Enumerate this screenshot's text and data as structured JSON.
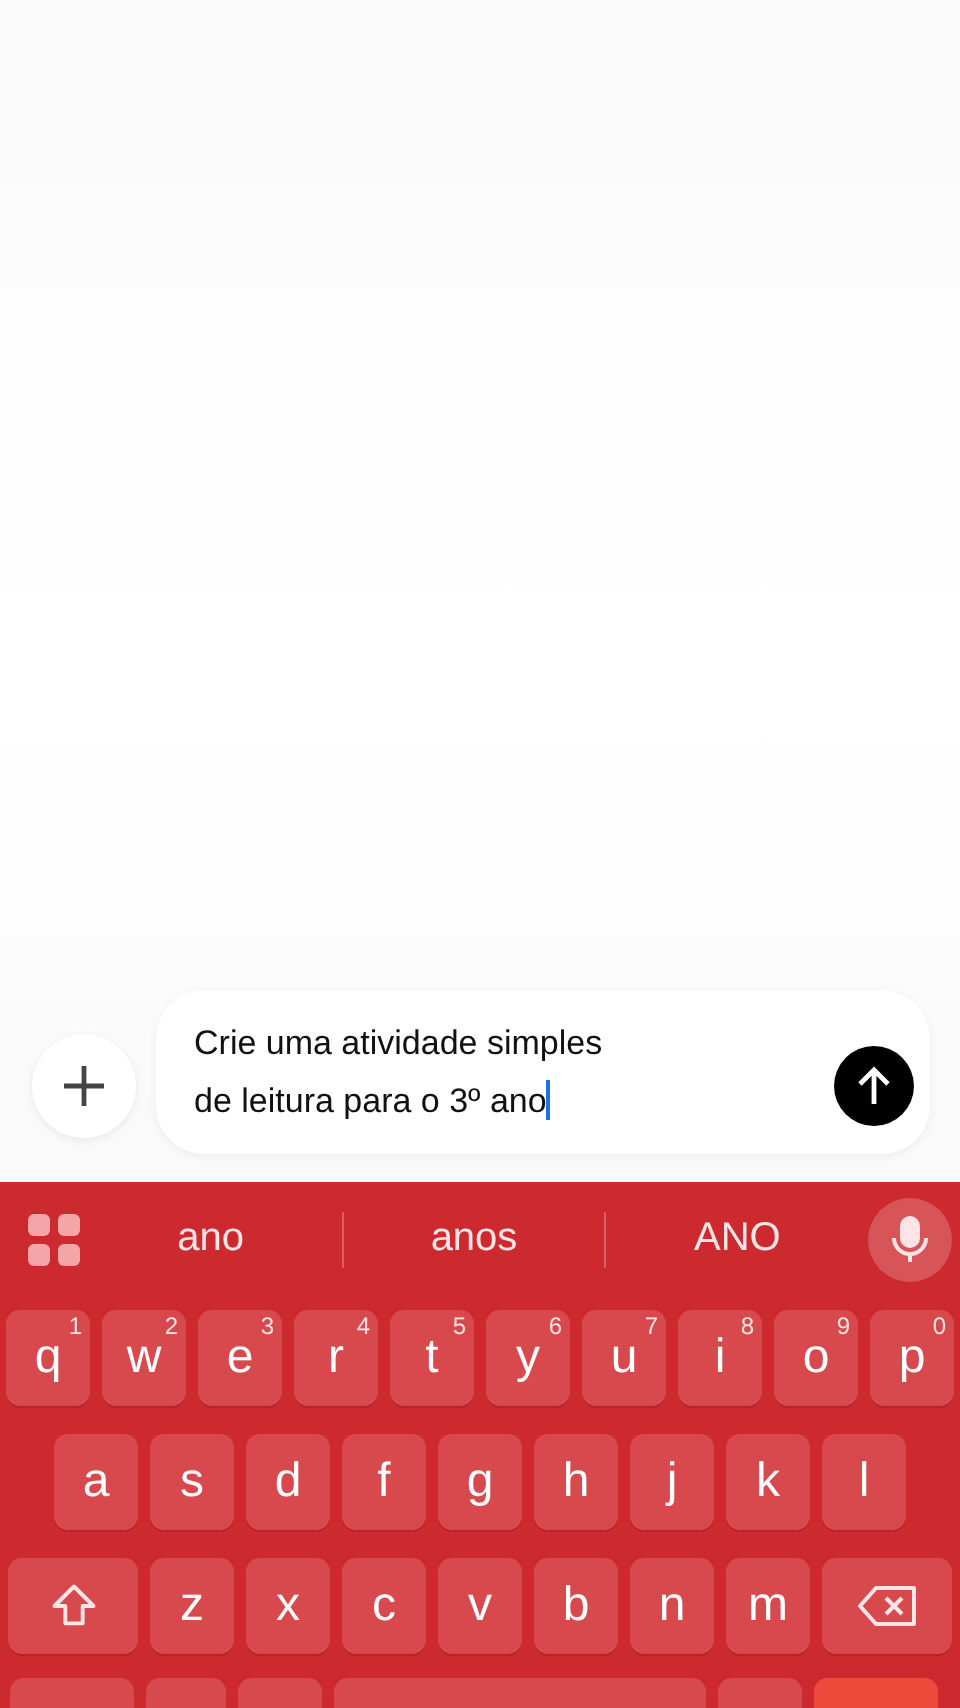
{
  "composer": {
    "text_lines": [
      "Crie uma atividade simples",
      "de leitura para o 3º ano"
    ]
  },
  "suggestions": [
    "ano",
    "anos",
    "ANO"
  ],
  "keyboard": {
    "rows": [
      [
        {
          "kind": "letter",
          "label": "q",
          "hint": "1"
        },
        {
          "kind": "letter",
          "label": "w",
          "hint": "2"
        },
        {
          "kind": "letter",
          "label": "e",
          "hint": "3"
        },
        {
          "kind": "letter",
          "label": "r",
          "hint": "4"
        },
        {
          "kind": "letter",
          "label": "t",
          "hint": "5"
        },
        {
          "kind": "letter",
          "label": "y",
          "hint": "6"
        },
        {
          "kind": "letter",
          "label": "u",
          "hint": "7"
        },
        {
          "kind": "letter",
          "label": "i",
          "hint": "8"
        },
        {
          "kind": "letter",
          "label": "o",
          "hint": "9"
        },
        {
          "kind": "letter",
          "label": "p",
          "hint": "0"
        }
      ],
      [
        {
          "kind": "letter",
          "label": "a"
        },
        {
          "kind": "letter",
          "label": "s"
        },
        {
          "kind": "letter",
          "label": "d"
        },
        {
          "kind": "letter",
          "label": "f"
        },
        {
          "kind": "letter",
          "label": "g"
        },
        {
          "kind": "letter",
          "label": "h"
        },
        {
          "kind": "letter",
          "label": "j"
        },
        {
          "kind": "letter",
          "label": "k"
        },
        {
          "kind": "letter",
          "label": "l"
        }
      ],
      [
        {
          "kind": "shift"
        },
        {
          "kind": "letter",
          "label": "z"
        },
        {
          "kind": "letter",
          "label": "x"
        },
        {
          "kind": "letter",
          "label": "c"
        },
        {
          "kind": "letter",
          "label": "v"
        },
        {
          "kind": "letter",
          "label": "b"
        },
        {
          "kind": "letter",
          "label": "n"
        },
        {
          "kind": "letter",
          "label": "m"
        },
        {
          "kind": "backspace"
        }
      ]
    ]
  }
}
